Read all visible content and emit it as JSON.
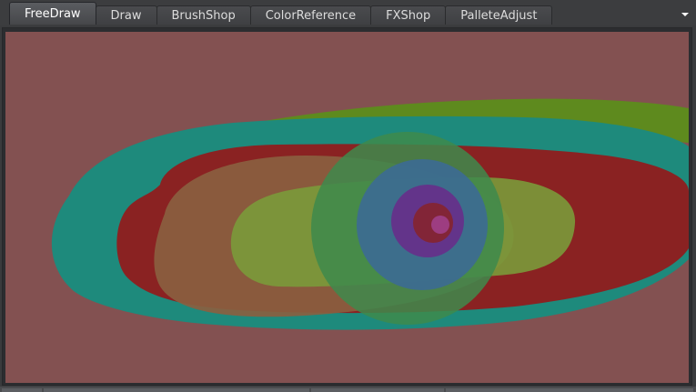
{
  "tabs": [
    {
      "label": "FreeDraw",
      "active": true
    },
    {
      "label": "Draw",
      "active": false
    },
    {
      "label": "BrushShop",
      "active": false
    },
    {
      "label": "ColorReference",
      "active": false
    },
    {
      "label": "FXShop",
      "active": false
    },
    {
      "label": "PalleteAdjust",
      "active": false
    }
  ],
  "icons": {
    "tab_menu": "chevron-down-icon"
  },
  "colors": {
    "canvas_background": "#835151",
    "stroke_olive_green": "#5e8a1e",
    "stroke_teal": "#1e8a7c",
    "stroke_dark_red": "#8a2222",
    "stroke_tan": "#8a6040",
    "stroke_yellow_green": "#7a9a3a",
    "stroke_green": "#3e8a4c",
    "stroke_blue": "#3c6a94",
    "stroke_purple": "#6a2a8a",
    "stroke_magenta": "#a0408a"
  }
}
